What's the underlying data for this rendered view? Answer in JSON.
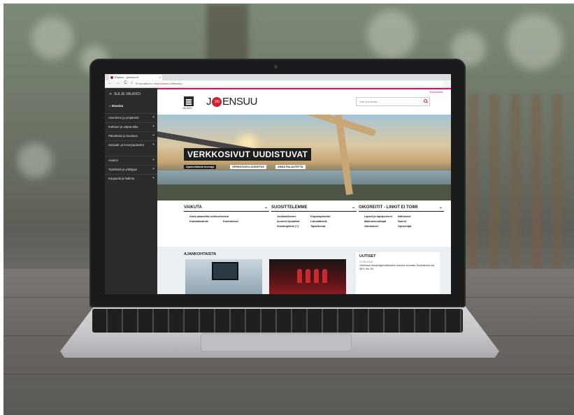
{
  "browser": {
    "tab_title": "Etusivu - joensuu.fi",
    "url": "Ei turvallinen | www.joensuu.fi/etusivu",
    "nav_glyphs": "← → C ⌂"
  },
  "sidebar": {
    "close_label": "SULJE VALIKKO",
    "home_label": "Etusivu",
    "items": [
      {
        "label": "Asuminen ja ympäristö"
      },
      {
        "label": "Kulttuuri ja vapaa-aika"
      },
      {
        "label": "Päivähoito ja koulutus"
      },
      {
        "label": "Sosiaali- ja terveyspalvelut"
      },
      {
        "label": "Avioimi"
      },
      {
        "label": "Työelämä ja yrittäjyys"
      },
      {
        "label": "Kaupunki ja hallinto"
      }
    ]
  },
  "header": {
    "lang_link": "Kieliversiot",
    "menu_label": "VALIKKO",
    "logo_pre": "J",
    "logo_badge": "170",
    "logo_post": "ENSUU",
    "search_placeholder": "Hae sivustolta..."
  },
  "hero": {
    "title": "VERKKOSIVUT UUDISTUVAT",
    "tags": [
      "Ajankohtaista teemoja",
      "VERKKOSIVU-UUDISTUS",
      "ANNA PALAUTETTA"
    ]
  },
  "quick": {
    "columns": [
      {
        "title": "VAIKUTA",
        "links": [
          "Anna palautetta verkkosivuista",
          "Kuntalaisaloite",
          "Kuulutukset"
        ]
      },
      {
        "title": "SUOSITTELEMME",
        "links": [
          "Joukkoliikenne",
          "Kirjastopalvelut",
          "Avoimet työpaikat",
          "Lakisääteisiä",
          "Slonämpöihin (?)",
          "Tapahtumat"
        ]
      },
      {
        "title": "OIKOREITIT - LINKIT EI TOIMI",
        "links": [
          "Lapset ja lapsiperheet",
          "Ikäihmiset",
          "Maahanmuuttajat",
          "Nuoret",
          "Vammaiset",
          "Opiskelijat"
        ]
      }
    ]
  },
  "news": {
    "ajankohtaista_title": "AJANKOHTAISTA",
    "uutiset_title": "UUTISET",
    "uutiset_date": "17.05.2018",
    "uutiset_text": "Joensuun kaupunginvaltuuston kokous suoraan Youtubessa ma 28.5. klo 18"
  },
  "colors": {
    "accent": "#c0186f",
    "logo_red": "#d3202e",
    "sidebar_bg": "#2b2b2c"
  }
}
